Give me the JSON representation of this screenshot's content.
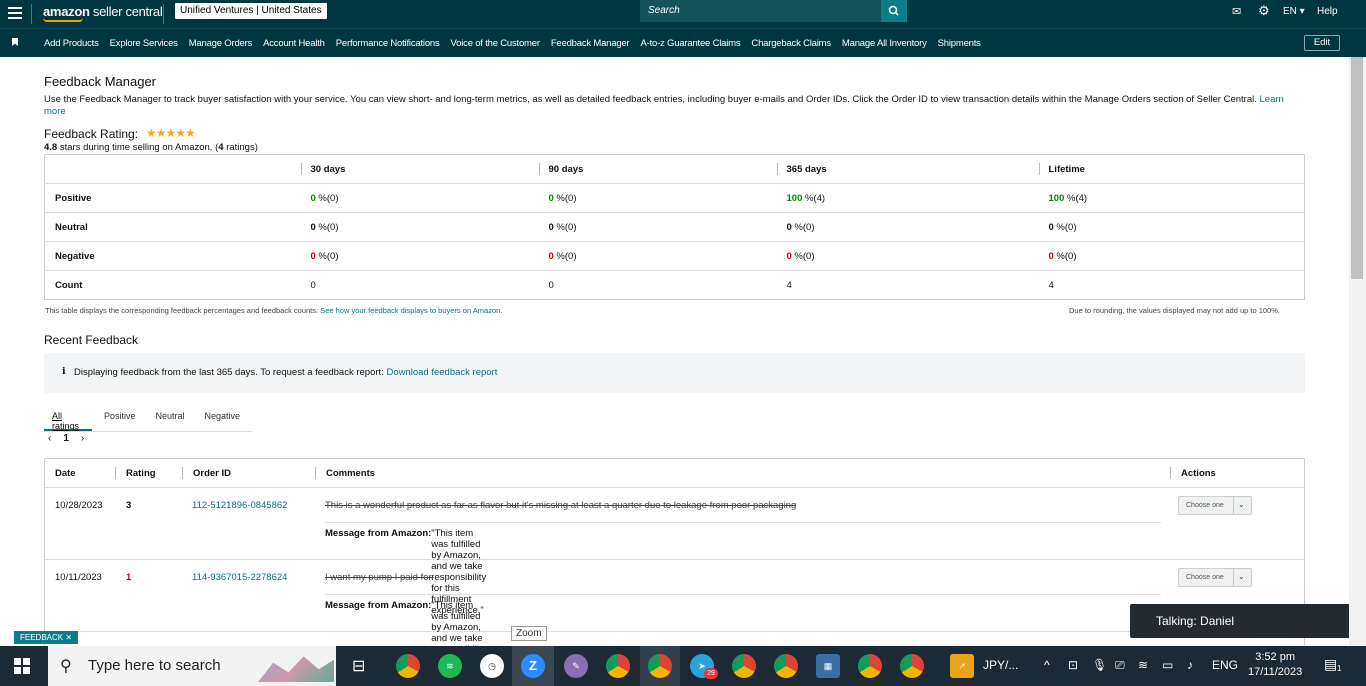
{
  "header": {
    "logo_prefix": "amazon",
    "logo_suffix": " seller central",
    "account": "Unified Ventures | United States",
    "search_placeholder": "Search",
    "language": "EN",
    "help": "Help"
  },
  "nav": {
    "items": [
      "Add Products",
      "Explore Services",
      "Manage Orders",
      "Account Health",
      "Performance Notifications",
      "Voice of the Customer",
      "Feedback Manager",
      "A-to-z Guarantee Claims",
      "Chargeback Claims",
      "Manage All Inventory",
      "Shipments"
    ],
    "edit": "Edit"
  },
  "page": {
    "title": "Feedback Manager",
    "intro": "Use the Feedback Manager to track buyer satisfaction with your service. You can view short- and long-term metrics, as well as detailed feedback entries, including buyer e-mails and Order IDs. Click the Order ID to view transaction details within the Manage Orders section of Seller Central.",
    "learn_more": "Learn more",
    "rating_title": "Feedback Rating:",
    "stars": "★★★★★",
    "rating_value": "4.8",
    "rating_text_1": " stars during time selling on Amazon. (",
    "rating_count": "4",
    "rating_text_2": " ratings)"
  },
  "metrics": {
    "columns": [
      "30 days",
      "90 days",
      "365 days",
      "Lifetime"
    ],
    "rows": [
      {
        "label": "Positive",
        "values": [
          [
            "0",
            " %(0)"
          ],
          [
            "0",
            " %(0)"
          ],
          [
            "100",
            " %(4)"
          ],
          [
            "100",
            " %(4)"
          ]
        ]
      },
      {
        "label": "Neutral",
        "values": [
          [
            "0",
            " %(0)"
          ],
          [
            "0",
            " %(0)"
          ],
          [
            "0",
            " %(0)"
          ],
          [
            "0",
            " %(0)"
          ]
        ]
      },
      {
        "label": "Negative",
        "values": [
          [
            "0",
            " %(0)"
          ],
          [
            "0",
            " %(0)"
          ],
          [
            "0",
            " %(0)"
          ],
          [
            "0",
            " %(0)"
          ]
        ]
      },
      {
        "label": "Count",
        "values": [
          [
            "0",
            ""
          ],
          [
            "0",
            ""
          ],
          [
            "4",
            ""
          ],
          [
            "4",
            ""
          ]
        ]
      }
    ],
    "note_left": "This table displays the corresponding feedback percentages and feedback counts.",
    "note_left_link": "See how your feedback displays to buyers on Amazon.",
    "note_right": "Due to rounding, the values displayed may not add up to 100%."
  },
  "recent": {
    "title": "Recent Feedback",
    "info": "Displaying feedback from the last 365 days. To request a feedback report:",
    "info_link": "Download feedback report",
    "tabs": [
      "All ratings",
      "Positive",
      "Neutral",
      "Negative"
    ],
    "page_prev": "‹",
    "page_num": "1",
    "page_next": "›",
    "columns": {
      "date": "Date",
      "rating": "Rating",
      "order": "Order ID",
      "comments": "Comments",
      "actions": "Actions"
    },
    "rows": [
      {
        "date": "10/28/2023",
        "rating": "3",
        "order": "112-5121896-0845862",
        "comment": "This is a wonderful product as far as flavor but it's missing at least a quarter due to leakage from poor packaging",
        "msg_label": "Message from Amazon:",
        "msg": " \"This item was fulfilled by Amazon, and we take responsibility for this fulfillment experience.\"",
        "action": "Choose one"
      },
      {
        "date": "10/11/2023",
        "rating": "1",
        "order": "114-9367015-2278624",
        "comment": "I want my pump I paid for.",
        "msg_label": "Message from Amazon:",
        "msg": " \"This item was fulfilled by Amazon, and we take responsibility for this fulfillment experience.\"",
        "action": "Choose one"
      }
    ]
  },
  "overlays": {
    "feedback_tag": "FEEDBACK ✕",
    "zoom": "Zoom",
    "talking": "Talking: Daniel"
  },
  "taskbar": {
    "search": "Type here to search",
    "currency": "JPY/...",
    "lang": "ENG",
    "time": "3:52 pm",
    "date": "17/11/2023",
    "badge": "29",
    "notif": "1"
  }
}
